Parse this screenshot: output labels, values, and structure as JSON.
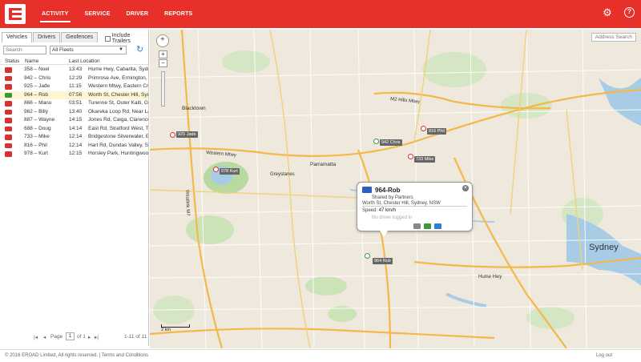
{
  "nav": {
    "items": [
      "ACTIVITY",
      "SERVICE",
      "DRIVER",
      "REPORTS"
    ]
  },
  "panel": {
    "tabs": [
      "Vehicles",
      "Drivers",
      "Geofences"
    ],
    "include_trailers": "Include Trailers",
    "search_placeholder": "Search",
    "fleet_value": "All Fleets",
    "headers": {
      "status": "Status",
      "name": "Name",
      "last_location": "Last Location"
    },
    "rows": [
      {
        "status": "red",
        "name": "358 – Noel",
        "time": "13:43",
        "location": "Hume Hwy, Cabarita, Sydney"
      },
      {
        "status": "red",
        "name": "942 – Chris",
        "time": "12:29",
        "location": "Primrose Ave, Ermington, Ry"
      },
      {
        "status": "red",
        "name": "925 – Jade",
        "time": "11:15",
        "location": "Western Mtwy, Eastern Cre"
      },
      {
        "status": "green",
        "name": "964 – Rob",
        "time": "07:56",
        "location": "Worth St, Chester Hill, Sydn"
      },
      {
        "status": "red",
        "name": "866 – Manu",
        "time": "03:51",
        "location": "Turenne St, Outer Kaiti, Gis"
      },
      {
        "status": "red",
        "name": "962 – Billy",
        "time": "13:40",
        "location": "Okareka Loop Rd, Near Lak"
      },
      {
        "status": "red",
        "name": "887 – Wayne",
        "time": "14:15",
        "location": "Jones Rd, Caiga, Clarence,"
      },
      {
        "status": "red",
        "name": "688 – Doug",
        "time": "14:14",
        "location": "East Rd, Stratford West, Ta"
      },
      {
        "status": "red",
        "name": "733 – Mike",
        "time": "12:14",
        "location": "Bridgestone Silverwater, Er"
      },
      {
        "status": "red",
        "name": "816 – Phil",
        "time": "12:14",
        "location": "Hart Rd, Dundas Valley, Sy"
      },
      {
        "status": "red",
        "name": "978 – Kurt",
        "time": "12:15",
        "location": "Horsley Park, Huntingwood"
      }
    ],
    "pager": {
      "page_label": "Page",
      "page_value": "1",
      "of_label": "of 1",
      "range": "1-11 of 11"
    }
  },
  "map": {
    "address_search": "Address Search",
    "city_label": "Sydney",
    "scale_label": "2 km",
    "markers": [
      {
        "label": "925 Jade",
        "color": "red"
      },
      {
        "label": "978 Kurt",
        "color": "red"
      },
      {
        "label": "942 Chris",
        "color": "green"
      },
      {
        "label": "816 Phil",
        "color": "red"
      },
      {
        "label": "733 Mike",
        "color": "red"
      },
      {
        "label": "964 Rob",
        "color": "green"
      }
    ],
    "road_labels": [
      "Western Mtwy",
      "M2 Hills Mtwy",
      "Hume Hwy",
      "Westlink M7",
      "Parramatta",
      "Greystanes",
      "Blacktown"
    ]
  },
  "popup": {
    "title": "964-Rob",
    "shared": "Shared by Partners",
    "address": "Worth St, Chester Hill, Sydney, NSW",
    "speed_label": "Speed:",
    "speed_value": "47 km/h",
    "driver": "No driver logged in"
  },
  "footer": {
    "copyright": "© 2016 EROAD Limited, All rights reserved.  |  Terms and Conditions",
    "logout": "Log out"
  },
  "colors": {
    "brand": "#e8302a",
    "status_red": "#d8322e",
    "status_green": "#3a9a3a"
  }
}
